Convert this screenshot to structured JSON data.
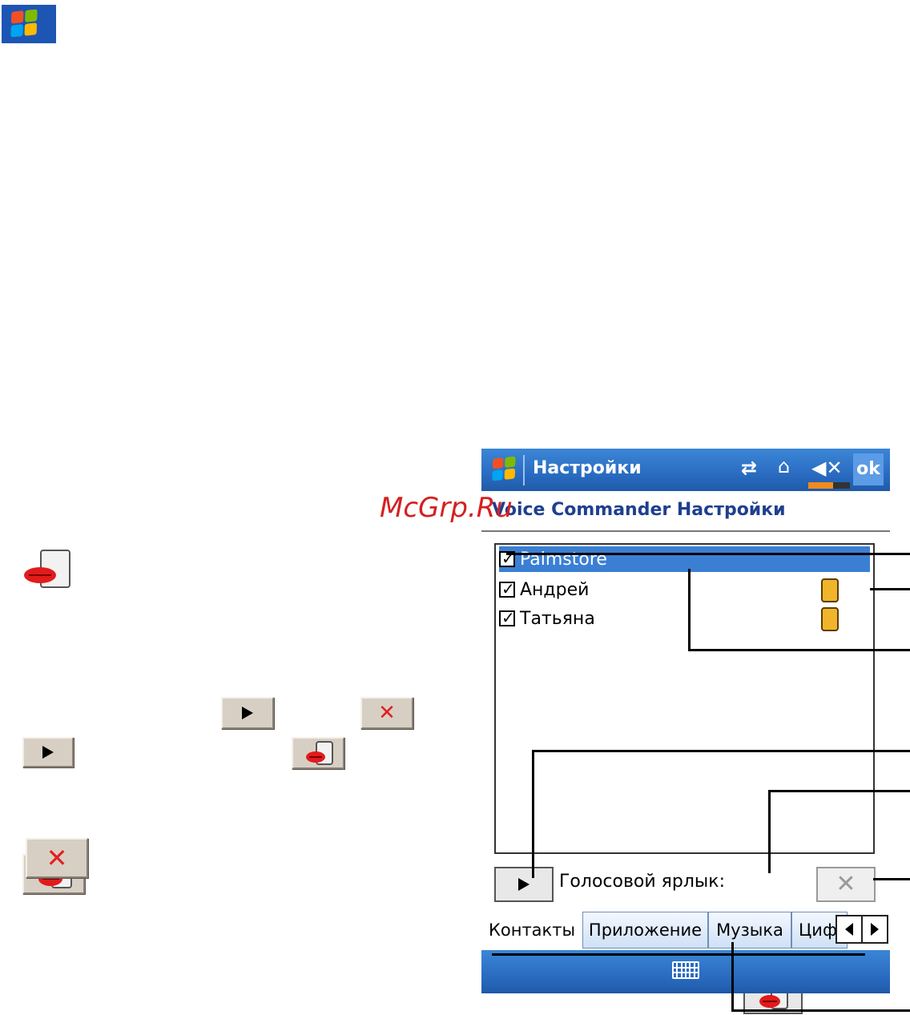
{
  "colors": {
    "titlebar": "#2a6cc2",
    "selection": "#3b7fd4",
    "heading": "#1f3f8f",
    "watermark": "#d62020",
    "sim_icon": "#f0b52a"
  },
  "icons": {
    "corner_logo": "windows-flag-icon",
    "record": "mic-tag-icon",
    "play": "play-icon",
    "delete": "x-icon",
    "keyboard": "keyboard-icon"
  },
  "watermark": "McGrp.Ru",
  "screen": {
    "title": "Настройки",
    "ok_label": "ok",
    "heading_prefix": "Vo",
    "heading": "ice Commander Настройки",
    "list_items": [
      {
        "label": "Palmstore",
        "checked": true,
        "selected": true,
        "sim": false
      },
      {
        "label": "Андрей",
        "checked": true,
        "selected": false,
        "sim": true
      },
      {
        "label": "Татьяна",
        "checked": true,
        "selected": false,
        "sim": true
      }
    ],
    "voice_tag_label": "Голосовой ярлык:",
    "tabs": [
      {
        "label": "Контакты",
        "active": true
      },
      {
        "label": "Приложение",
        "active": false
      },
      {
        "label": "Музыка",
        "active": false
      },
      {
        "label": "Циф",
        "active": false
      }
    ]
  }
}
